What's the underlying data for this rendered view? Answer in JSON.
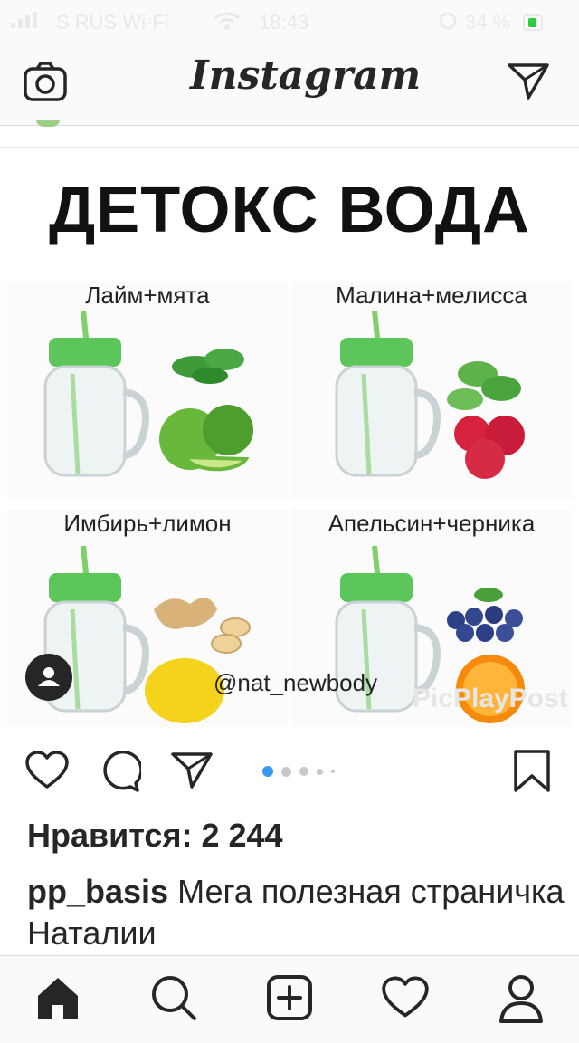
{
  "status_bar": {
    "carrier": "S RUS Wi-Fi",
    "time": "18:43",
    "battery": "34 %"
  },
  "header": {
    "logo_text": "Instagram",
    "camera_icon": "camera-icon",
    "direct_icon": "paper-plane-icon"
  },
  "post": {
    "image": {
      "title": "ДЕТОКС  ВОДА",
      "panels": [
        {
          "label": "Лайм+мята",
          "ingredients": [
            "mint",
            "lime"
          ]
        },
        {
          "label": "Малина+мелисса",
          "ingredients": [
            "lemon-balm",
            "raspberry"
          ]
        },
        {
          "label": "Имбирь+лимон",
          "ingredients": [
            "ginger",
            "lemon"
          ]
        },
        {
          "label": "Апельсин+черника",
          "ingredients": [
            "blueberry",
            "orange"
          ]
        }
      ],
      "tag": "@nat_newbody",
      "watermark": "PicPlayPost"
    },
    "carousel": {
      "count": 5,
      "active_index": 0
    },
    "likes_text": "Нравится: 2 244",
    "caption": {
      "username": "pp_basis",
      "text": "Мега полезная страничка Наталии"
    }
  },
  "colors": {
    "accent": "#3897f0",
    "text": "#262626",
    "border": "#dbdbdb",
    "jar_lid": "#5cc65a"
  },
  "tab_bar": {
    "items": [
      "home-icon",
      "search-icon",
      "new-post-icon",
      "activity-icon",
      "profile-icon"
    ]
  }
}
